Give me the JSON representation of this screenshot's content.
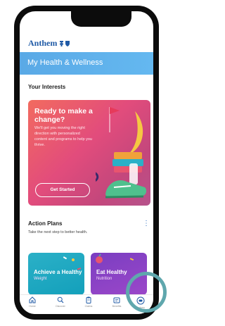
{
  "app": {
    "brand": "Anthem"
  },
  "header": {
    "title": "My Health & Wellness"
  },
  "interests": {
    "section_title": "Your Interests",
    "card": {
      "title": "Ready to make a change?",
      "body": "We'll get you moving the right direction with personalized content and programs to help you thrive.",
      "button": "Get Started"
    }
  },
  "action_plans": {
    "title": "Action Plans",
    "subtitle": "Take the next step to better health.",
    "cards": [
      {
        "title": "Achieve a Healthy",
        "subtitle": "Weight"
      },
      {
        "title": "Eat Healthy",
        "subtitle": "Nutrition"
      }
    ]
  },
  "tabs": [
    {
      "label": "Home",
      "icon": "home-icon"
    },
    {
      "label": "Discover",
      "icon": "search-icon"
    },
    {
      "label": "Claims",
      "icon": "clipboard-icon"
    },
    {
      "label": "Benefits",
      "icon": "id-card-icon"
    },
    {
      "label": "Sydney",
      "icon": "chat-bot-icon"
    }
  ],
  "colors": {
    "brand": "#1f5aa6",
    "header_band": "#5aa9e6",
    "hero_gradient_start": "#f26b5f",
    "hero_gradient_end": "#b6528b",
    "card_teal": "#13a0bb",
    "card_purple": "#7a3ec1",
    "highlight_ring": "#5fa7ad"
  }
}
